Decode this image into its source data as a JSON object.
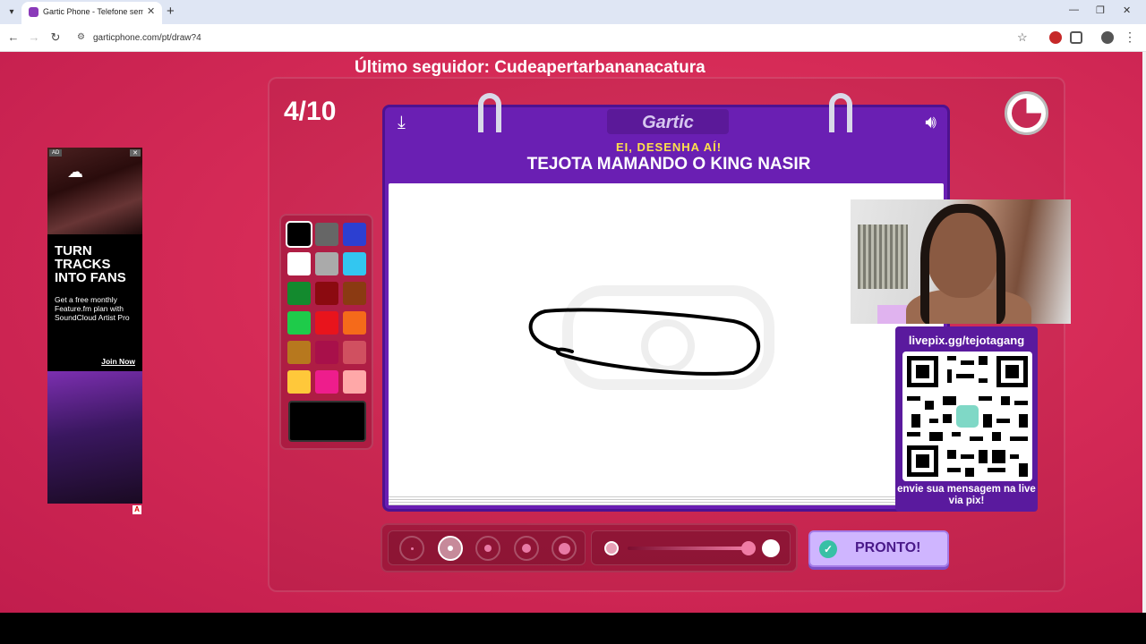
{
  "browser": {
    "tab_title": "Gartic Phone - Telefone sem fio",
    "tab_close": "✕",
    "new_tab": "+",
    "url": "garticphone.com/pt/draw?4",
    "window_controls": {
      "minimize": "—",
      "restore": "❐",
      "close": "✕"
    }
  },
  "stream": {
    "follower_banner": "Último seguidor: Cudeapertarbananacatura",
    "pix": {
      "title": "livepix.gg/tejotagang",
      "subtitle": "envie sua mensagem na live via pix!"
    }
  },
  "game": {
    "round": "4/10",
    "logo": "Gartic",
    "prompt_label": "EI, DESENHA AÍ!",
    "prompt_text": "TEJOTA MAMANDO O KING NASIR",
    "done_label": "PRONTO!",
    "selected_color": "#000000",
    "selected_brush_size_index": 1,
    "opacity": 1.0,
    "palette": [
      "#000000",
      "#666666",
      "#2c3fd1",
      "#ffffff",
      "#aaaaaa",
      "#33c6f0",
      "#138a2e",
      "#8b0a10",
      "#8b3a12",
      "#1ecb4a",
      "#e8141c",
      "#f56a1a",
      "#b7781e",
      "#a8104a",
      "#d05060",
      "#ffc83a",
      "#ee1d8c",
      "#ffa8a8"
    ]
  },
  "ad": {
    "badge": "AD",
    "headline": "TURN TRACKS INTO FANS",
    "body": "Get a free monthly Feature.fm plan with SoundCloud Artist Pro",
    "cta": "Join Now"
  }
}
